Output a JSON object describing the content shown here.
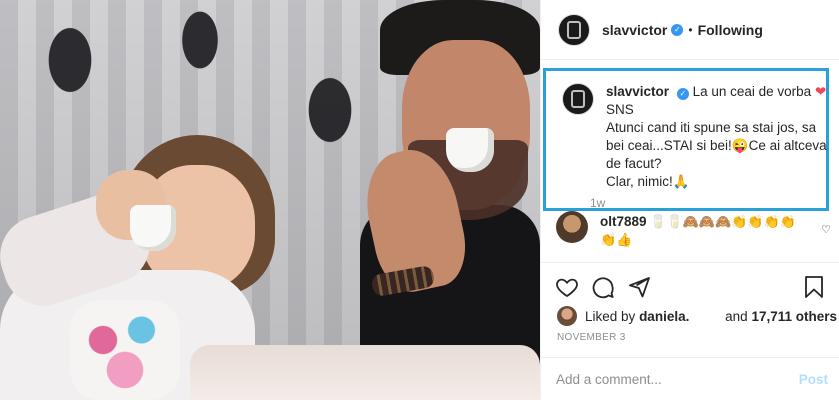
{
  "header": {
    "username": "slavvictor",
    "verified_icon": "✓",
    "separator": "•",
    "follow_status": "Following"
  },
  "caption": {
    "username": "slavvictor",
    "verified_icon": "✓",
    "line1": "La un ceai de vorba",
    "heart": "❤",
    "line2": "SNS",
    "line3": "Atunci cand iti spune sa stai jos, sa bei ceai...STAI si bei!😜Ce ai altceva de facut?",
    "line4": "Clar, nimic!🙏",
    "time": "1w"
  },
  "comment": {
    "username": "olt7889",
    "emojis": "🥛🥛🙈🙈🙈👏👏👏👏👏👍",
    "heart_icon": "♡"
  },
  "likes": {
    "prefix": "Liked by",
    "user": "daniela.",
    "and": "and",
    "count": "17,711 others"
  },
  "date": "NOVEMBER 3",
  "add_comment": {
    "placeholder": "Add a comment...",
    "post_label": "Post"
  },
  "colors": {
    "verified": "#3897f0",
    "highlight_border": "#2aa0d9",
    "post_disabled": "#b2dffc"
  }
}
